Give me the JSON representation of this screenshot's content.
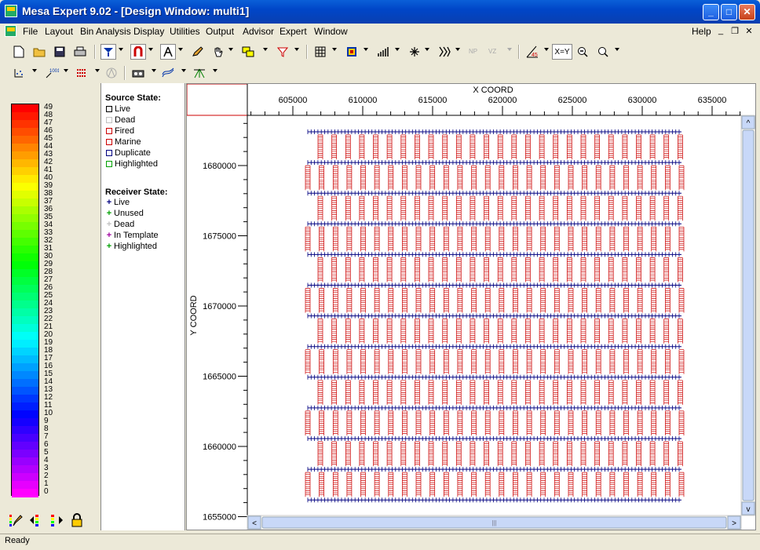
{
  "window": {
    "title": "Mesa Expert 9.02 - [Design Window: multi1]",
    "minimize": "_",
    "maximize": "□",
    "close": "✕"
  },
  "menu": {
    "items": [
      "File",
      "Layout",
      "Bin Analysis",
      "Display",
      "Utilities",
      "Output",
      "Advisor",
      "Expert",
      "Window"
    ],
    "help": "Help",
    "mdi_min": "_",
    "mdi_restore": "❐",
    "mdi_close": "✕"
  },
  "toolbar": {
    "xy_label": "X=Y"
  },
  "colorbar": {
    "labels": [
      "49",
      "48",
      "47",
      "46",
      "45",
      "44",
      "43",
      "42",
      "41",
      "40",
      "39",
      "38",
      "37",
      "36",
      "35",
      "34",
      "33",
      "32",
      "31",
      "30",
      "29",
      "28",
      "27",
      "26",
      "25",
      "24",
      "23",
      "22",
      "21",
      "20",
      "19",
      "18",
      "17",
      "16",
      "15",
      "14",
      "13",
      "12",
      "11",
      "10",
      "9",
      "8",
      "7",
      "6",
      "5",
      "4",
      "3",
      "2",
      "1",
      "0"
    ]
  },
  "legend": {
    "source_title": "Source State:",
    "source_items": [
      {
        "label": "Live",
        "color": "#000000"
      },
      {
        "label": "Dead",
        "color": "#c0c0c0"
      },
      {
        "label": "Fired",
        "color": "#cc0000"
      },
      {
        "label": "Marine",
        "color": "#cc0000"
      },
      {
        "label": "Duplicate",
        "color": "#000080"
      },
      {
        "label": "Highlighted",
        "color": "#00a000"
      }
    ],
    "receiver_title": "Receiver State:",
    "receiver_items": [
      {
        "label": "Live",
        "color": "#000080"
      },
      {
        "label": "Unused",
        "color": "#00a000"
      },
      {
        "label": "Dead",
        "color": "#c0c0c0"
      },
      {
        "label": "In Template",
        "color": "#a000a0"
      },
      {
        "label": "Highlighted",
        "color": "#00a000"
      }
    ]
  },
  "plot": {
    "x_axis_title": "X COORD",
    "y_axis_title": "Y COORD",
    "x_tick_labels": [
      "605000",
      "610000",
      "615000",
      "620000",
      "625000",
      "630000",
      "635000"
    ],
    "y_tick_labels": [
      "1680000",
      "1675000",
      "1670000",
      "1665000",
      "1660000",
      "1655000"
    ],
    "source_color": "#cc0000",
    "receiver_color": "#000080",
    "scroll_left": "<",
    "scroll_right": ">",
    "scroll_up": "^",
    "scroll_down": "v",
    "scroll_grip": "|||"
  },
  "status": {
    "text": "Ready"
  }
}
